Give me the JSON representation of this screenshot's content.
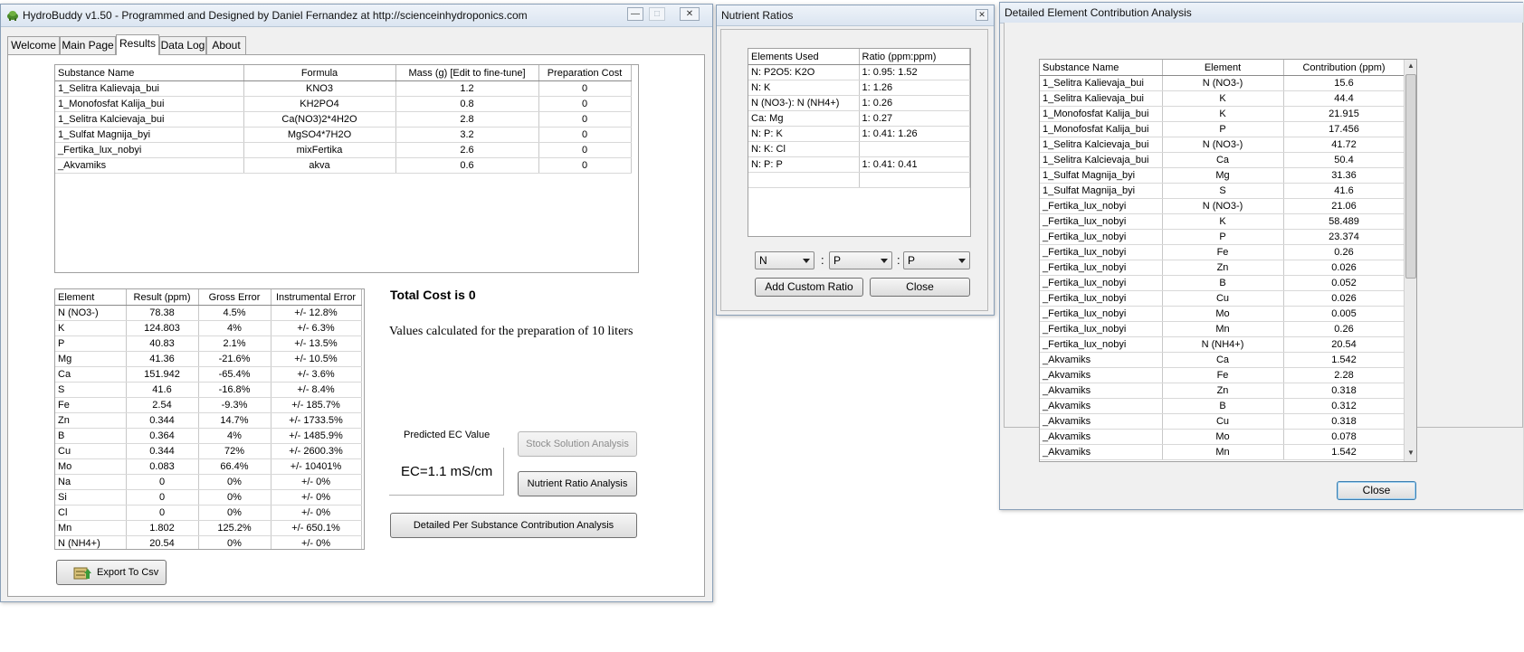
{
  "main_window": {
    "title": "HydroBuddy v1.50 - Programmed and Designed by Daniel Fernandez at http://scienceinhydroponics.com",
    "tabs": [
      "Welcome",
      "Main Page",
      "Results",
      "Data Log",
      "About"
    ],
    "active_tab": "Results",
    "substances": {
      "columns": [
        "Substance Name",
        "Formula",
        "Mass (g) [Edit to fine-tune]",
        "Preparation Cost"
      ],
      "rows": [
        [
          "1_Selitra Kalievaja_bui",
          "KNO3",
          "1.2",
          "0"
        ],
        [
          "1_Monofosfat Kalija_bui",
          "KH2PO4",
          "0.8",
          "0"
        ],
        [
          "1_Selitra Kalcievaja_bui",
          "Ca(NO3)2*4H2O",
          "2.8",
          "0"
        ],
        [
          "1_Sulfat Magnija_byi",
          "MgSO4*7H2O",
          "3.2",
          "0"
        ],
        [
          "_Fertika_lux_nobyi",
          "mixFertika",
          "2.6",
          "0"
        ],
        [
          "_Akvamiks",
          "akva",
          "0.6",
          "0"
        ]
      ]
    },
    "elements": {
      "columns": [
        "Element",
        "Result (ppm)",
        "Gross Error",
        "Instrumental Error"
      ],
      "rows": [
        [
          "N (NO3-)",
          "78.38",
          "4.5%",
          "+/- 12.8%"
        ],
        [
          "K",
          "124.803",
          "4%",
          "+/- 6.3%"
        ],
        [
          "P",
          "40.83",
          "2.1%",
          "+/- 13.5%"
        ],
        [
          "Mg",
          "41.36",
          "-21.6%",
          "+/- 10.5%"
        ],
        [
          "Ca",
          "151.942",
          "-65.4%",
          "+/- 3.6%"
        ],
        [
          "S",
          "41.6",
          "-16.8%",
          "+/- 8.4%"
        ],
        [
          "Fe",
          "2.54",
          "-9.3%",
          "+/- 185.7%"
        ],
        [
          "Zn",
          "0.344",
          "14.7%",
          "+/- 1733.5%"
        ],
        [
          "B",
          "0.364",
          "4%",
          "+/- 1485.9%"
        ],
        [
          "Cu",
          "0.344",
          "72%",
          "+/- 2600.3%"
        ],
        [
          "Mo",
          "0.083",
          "66.4%",
          "+/- 10401%"
        ],
        [
          "Na",
          "0",
          "0%",
          "+/- 0%"
        ],
        [
          "Si",
          "0",
          "0%",
          "+/- 0%"
        ],
        [
          "Cl",
          "0",
          "0%",
          "+/- 0%"
        ],
        [
          "Mn",
          "1.802",
          "125.2%",
          "+/- 650.1%"
        ],
        [
          "N (NH4+)",
          "20.54",
          "0%",
          "+/- 0%"
        ]
      ]
    },
    "total_cost": "Total Cost is 0",
    "values_note": "Values calculated for the preparation of 10 liters",
    "ec_label": "Predicted EC Value",
    "ec_value": "EC=1.1 mS/cm",
    "buttons": {
      "stock": "Stock Solution Analysis",
      "ratio": "Nutrient Ratio Analysis",
      "detailed": "Detailed Per Substance Contribution Analysis",
      "export": "Export To Csv"
    }
  },
  "ratios_window": {
    "title": "Nutrient Ratios",
    "columns": [
      "Elements Used",
      "Ratio (ppm:ppm)"
    ],
    "rows": [
      [
        "N: P2O5: K2O",
        "1: 0.95: 1.52"
      ],
      [
        "N: K",
        "1: 1.26"
      ],
      [
        "N (NO3-): N (NH4+)",
        "1: 0.26"
      ],
      [
        "Ca: Mg",
        "1: 0.27"
      ],
      [
        "N: P: K",
        "1: 0.41: 1.26"
      ],
      [
        "N: K: Cl",
        ""
      ],
      [
        "N: P: P",
        "1: 0.41: 0.41"
      ],
      [
        "",
        ""
      ]
    ],
    "combo1": "N",
    "combo2": "P",
    "combo3": "P",
    "separator": ":",
    "add_button": "Add Custom Ratio",
    "close_button": "Close"
  },
  "detail_window": {
    "title": "Detailed Element Contribution Analysis",
    "columns": [
      "Substance Name",
      "Element",
      "Contribution (ppm)"
    ],
    "rows": [
      [
        "1_Selitra Kalievaja_bui",
        "N (NO3-)",
        "15.6"
      ],
      [
        "1_Selitra Kalievaja_bui",
        "K",
        "44.4"
      ],
      [
        "1_Monofosfat Kalija_bui",
        "K",
        "21.915"
      ],
      [
        "1_Monofosfat Kalija_bui",
        "P",
        "17.456"
      ],
      [
        "1_Selitra Kalcievaja_bui",
        "N (NO3-)",
        "41.72"
      ],
      [
        "1_Selitra Kalcievaja_bui",
        "Ca",
        "50.4"
      ],
      [
        "1_Sulfat Magnija_byi",
        "Mg",
        "31.36"
      ],
      [
        "1_Sulfat Magnija_byi",
        "S",
        "41.6"
      ],
      [
        "_Fertika_lux_nobyi",
        "N (NO3-)",
        "21.06"
      ],
      [
        "_Fertika_lux_nobyi",
        "K",
        "58.489"
      ],
      [
        "_Fertika_lux_nobyi",
        "P",
        "23.374"
      ],
      [
        "_Fertika_lux_nobyi",
        "Fe",
        "0.26"
      ],
      [
        "_Fertika_lux_nobyi",
        "Zn",
        "0.026"
      ],
      [
        "_Fertika_lux_nobyi",
        "B",
        "0.052"
      ],
      [
        "_Fertika_lux_nobyi",
        "Cu",
        "0.026"
      ],
      [
        "_Fertika_lux_nobyi",
        "Mo",
        "0.005"
      ],
      [
        "_Fertika_lux_nobyi",
        "Mn",
        "0.26"
      ],
      [
        "_Fertika_lux_nobyi",
        "N (NH4+)",
        "20.54"
      ],
      [
        "_Akvamiks",
        "Ca",
        "1.542"
      ],
      [
        "_Akvamiks",
        "Fe",
        "2.28"
      ],
      [
        "_Akvamiks",
        "Zn",
        "0.318"
      ],
      [
        "_Akvamiks",
        "B",
        "0.312"
      ],
      [
        "_Akvamiks",
        "Cu",
        "0.318"
      ],
      [
        "_Akvamiks",
        "Mo",
        "0.078"
      ],
      [
        "_Akvamiks",
        "Mn",
        "1.542"
      ]
    ],
    "close_button": "Close"
  }
}
